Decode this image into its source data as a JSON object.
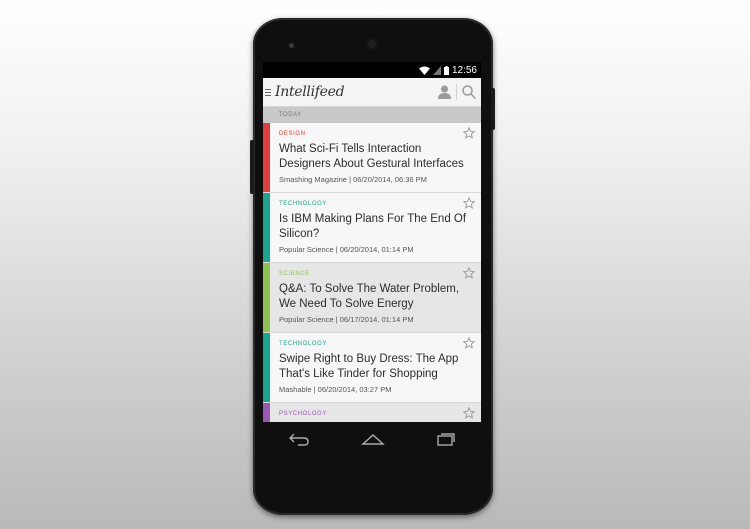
{
  "status_bar": {
    "time": "12:56"
  },
  "app": {
    "logo": "Intellifeed"
  },
  "section": {
    "label": "TODAY"
  },
  "feed": [
    {
      "category": "DESIGN",
      "category_color": "#e23b3b",
      "title": "What Sci-Fi Tells Interaction Designers About Gestural Interfaces",
      "source": "Smashing Magazine",
      "separator": "|",
      "datetime": "06/20/2014, 06:36 PM"
    },
    {
      "category": "TECHNOLOGY",
      "category_color": "#1aa68c",
      "title": "Is IBM Making Plans For The End Of Silicon?",
      "source": "Popular Science",
      "separator": "|",
      "datetime": "06/20/2014, 01:14 PM"
    },
    {
      "category": "SCIENCE",
      "category_color": "#8cc152",
      "title": "Q&A: To Solve The Water Problem, We Need To Solve Energy",
      "source": "Popular Science",
      "separator": "|",
      "datetime": "06/17/2014, 01:14 PM"
    },
    {
      "category": "TECHNOLOGY",
      "category_color": "#1aa68c",
      "title": "Swipe Right to Buy Dress: The App That's Like Tinder for Shopping",
      "source": "Mashable",
      "separator": "|",
      "datetime": "06/20/2014, 03:27 PM"
    },
    {
      "category": "PSYCHOLOGY",
      "category_color": "#9b59b6",
      "title": "",
      "source": "",
      "separator": "",
      "datetime": ""
    }
  ],
  "icons": {
    "status": [
      "wifi-icon",
      "signal-icon",
      "battery-icon"
    ],
    "appbar": [
      "menu-icon",
      "profile-icon",
      "search-icon"
    ],
    "card": "star-icon",
    "nav": [
      "back-icon",
      "home-icon",
      "recents-icon"
    ]
  },
  "colors": {
    "design": "#e23b3b",
    "technology": "#1aa68c",
    "science": "#8cc152",
    "psychology": "#9b59b6"
  }
}
